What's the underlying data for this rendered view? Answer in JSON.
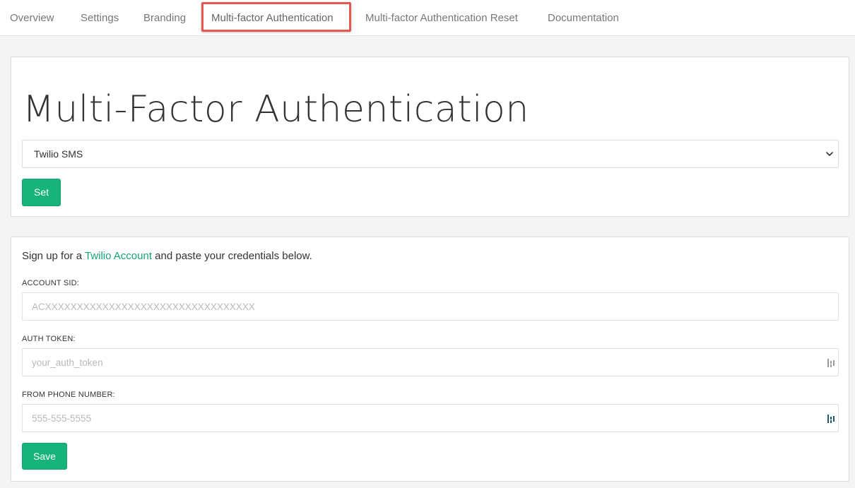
{
  "tabs": [
    {
      "label": "Overview"
    },
    {
      "label": "Settings"
    },
    {
      "label": "Branding"
    },
    {
      "label": "Multi-factor Authentication",
      "active": true
    },
    {
      "label": "Multi-factor Authentication Reset"
    },
    {
      "label": "Documentation"
    }
  ],
  "mfa": {
    "title": "Multi-Factor Authentication",
    "provider_selected": "Twilio SMS",
    "set_label": "Set"
  },
  "twilio": {
    "intro_prefix": "Sign up for a ",
    "intro_link": "Twilio Account",
    "intro_suffix": " and paste your credentials below.",
    "account_sid_label": "ACCOUNT SID:",
    "account_sid_placeholder": "ACXXXXXXXXXXXXXXXXXXXXXXXXXXXXXXXXX",
    "auth_token_label": "AUTH TOKEN:",
    "auth_token_placeholder": "your_auth_token",
    "from_phone_label": "FROM PHONE NUMBER:",
    "from_phone_placeholder": "555-555-5555",
    "save_label": "Save"
  },
  "colors": {
    "accent": "#16b47a",
    "link": "#16a377",
    "highlight": "#e5584f"
  },
  "icons": {
    "select_chevron": "chevron-down-icon",
    "field_manager": "password-manager-icon"
  }
}
